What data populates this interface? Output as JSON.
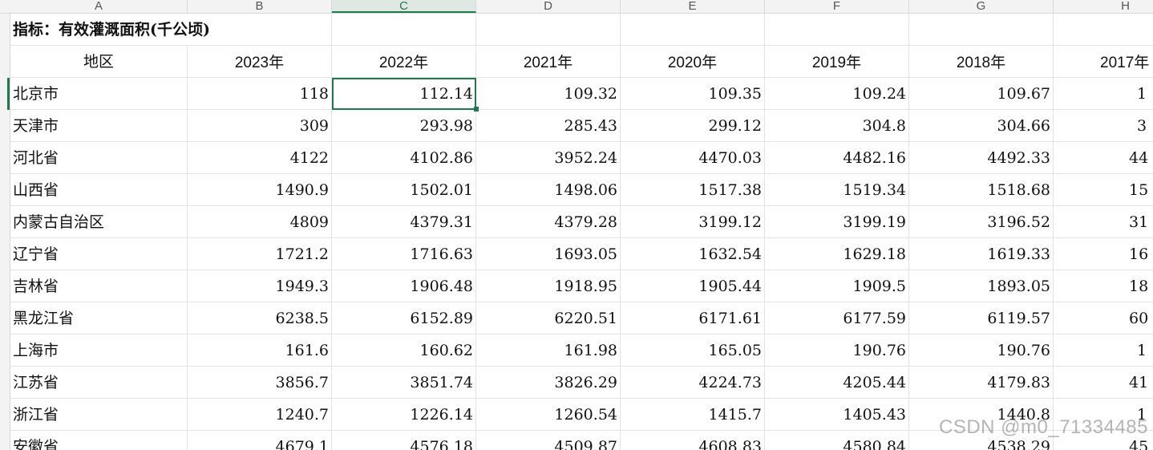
{
  "column_headers": [
    {
      "id": "A",
      "label": "A"
    },
    {
      "id": "B",
      "label": "B"
    },
    {
      "id": "C",
      "label": "C",
      "active": true
    },
    {
      "id": "D",
      "label": "D"
    },
    {
      "id": "E",
      "label": "E"
    },
    {
      "id": "F",
      "label": "F"
    },
    {
      "id": "G",
      "label": "G"
    },
    {
      "id": "H",
      "label": "H"
    }
  ],
  "title": "指标：有效灌溉面积(千公顷)",
  "header": {
    "region": "地区",
    "years": [
      "2023年",
      "2022年",
      "2021年",
      "2020年",
      "2019年",
      "2018年",
      "2017年"
    ]
  },
  "rows": [
    {
      "region": "北京市",
      "v": [
        "118",
        "112.14",
        "109.32",
        "109.35",
        "109.24",
        "109.67",
        "1"
      ]
    },
    {
      "region": "天津市",
      "v": [
        "309",
        "293.98",
        "285.43",
        "299.12",
        "304.8",
        "304.66",
        "3"
      ]
    },
    {
      "region": "河北省",
      "v": [
        "4122",
        "4102.86",
        "3952.24",
        "4470.03",
        "4482.16",
        "4492.33",
        "44"
      ]
    },
    {
      "region": "山西省",
      "v": [
        "1490.9",
        "1502.01",
        "1498.06",
        "1517.38",
        "1519.34",
        "1518.68",
        "15"
      ]
    },
    {
      "region": "内蒙古自治区",
      "v": [
        "4809",
        "4379.31",
        "4379.28",
        "3199.12",
        "3199.19",
        "3196.52",
        "31"
      ]
    },
    {
      "region": "辽宁省",
      "v": [
        "1721.2",
        "1716.63",
        "1693.05",
        "1632.54",
        "1629.18",
        "1619.33",
        "16"
      ]
    },
    {
      "region": "吉林省",
      "v": [
        "1949.3",
        "1906.48",
        "1918.95",
        "1905.44",
        "1909.5",
        "1893.05",
        "18"
      ]
    },
    {
      "region": "黑龙江省",
      "v": [
        "6238.5",
        "6152.89",
        "6220.51",
        "6171.61",
        "6177.59",
        "6119.57",
        "60"
      ]
    },
    {
      "region": "上海市",
      "v": [
        "161.6",
        "160.62",
        "161.98",
        "165.05",
        "190.76",
        "190.76",
        "1"
      ]
    },
    {
      "region": "江苏省",
      "v": [
        "3856.7",
        "3851.74",
        "3826.29",
        "4224.73",
        "4205.44",
        "4179.83",
        "41"
      ]
    },
    {
      "region": "浙江省",
      "v": [
        "1240.7",
        "1226.14",
        "1260.54",
        "1415.7",
        "1405.43",
        "1440.8",
        "1"
      ]
    },
    {
      "region": "安徽省",
      "v": [
        "4679.1",
        "4576.18",
        "4509.87",
        "4608.83",
        "4580.84",
        "4538.29",
        "45"
      ]
    }
  ],
  "active_cell": "C3",
  "watermark": "CSDN @m0_71334485",
  "colors": {
    "accent": "#1f7a4f",
    "grid": "#e3e3e3",
    "header_bg": "#f3f3f3"
  }
}
